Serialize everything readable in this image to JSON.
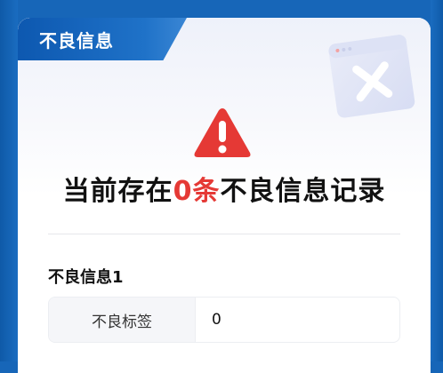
{
  "header": {
    "title": "不良信息"
  },
  "summary": {
    "prefix": "当前存在",
    "count": "0条",
    "suffix": "不良信息记录"
  },
  "section": {
    "title": "不良信息1",
    "rows": [
      {
        "label": "不良标签",
        "value": "0"
      }
    ]
  },
  "colors": {
    "brand_blue": "#1766b8",
    "warning_red": "#e53935",
    "count_red": "#e53935"
  },
  "icons": {
    "warning": "warning-triangle-icon",
    "decoration": "error-window-icon"
  }
}
